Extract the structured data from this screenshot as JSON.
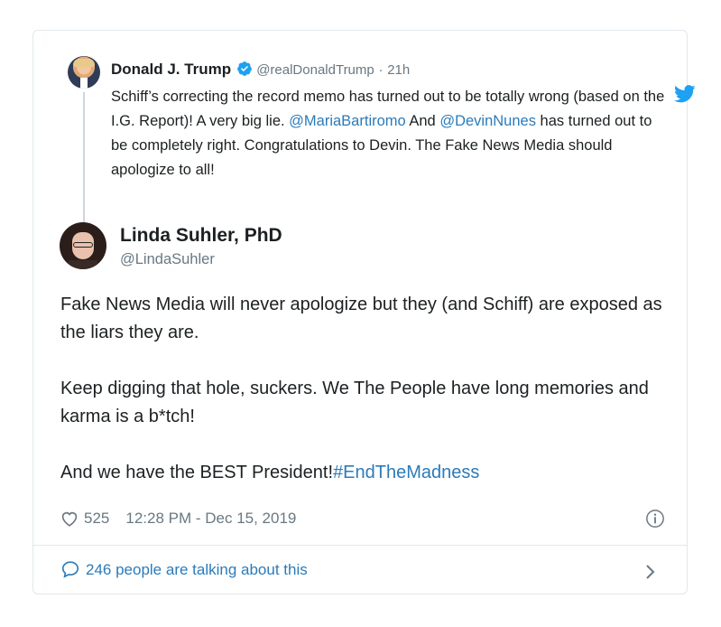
{
  "parent_tweet": {
    "name": "Donald J. Trump",
    "handle": "@realDonaldTrump",
    "separator": "·",
    "time": "21h",
    "text": {
      "part1": "Schiff’s correcting the record memo has turned out to be totally wrong (based on the I.G. Report)! A very big lie. ",
      "mention1": "@MariaBartiromo",
      "part2": " And ",
      "mention2": "@DevinNunes",
      "part3": " has turned out to be completely right. Congratulations to Devin. The Fake News Media should apologize to all!"
    },
    "verified_icon": "verified-badge-icon",
    "brand_icon": "twitter-bird-icon"
  },
  "tweet": {
    "name": "Linda Suhler, PhD",
    "handle": "@LindaSuhler",
    "paragraphs": {
      "p1": "Fake News Media will never apologize but they (and Schiff) are exposed as the liars they are.",
      "p2": "Keep digging that hole, suckers. We The People have long memories and karma is a b*tch!",
      "p3_text": "And we have the BEST President!",
      "p3_hashtag": "#EndTheMadness"
    },
    "likes": "525",
    "timestamp": "12:28 PM - Dec 15, 2019"
  },
  "footer": {
    "label": "246 people are talking about this"
  },
  "colors": {
    "link": "#2b7bb9",
    "muted": "#697882",
    "text": "#1c2022",
    "border": "#e1e8ed",
    "twitter_blue": "#1da1f2"
  }
}
